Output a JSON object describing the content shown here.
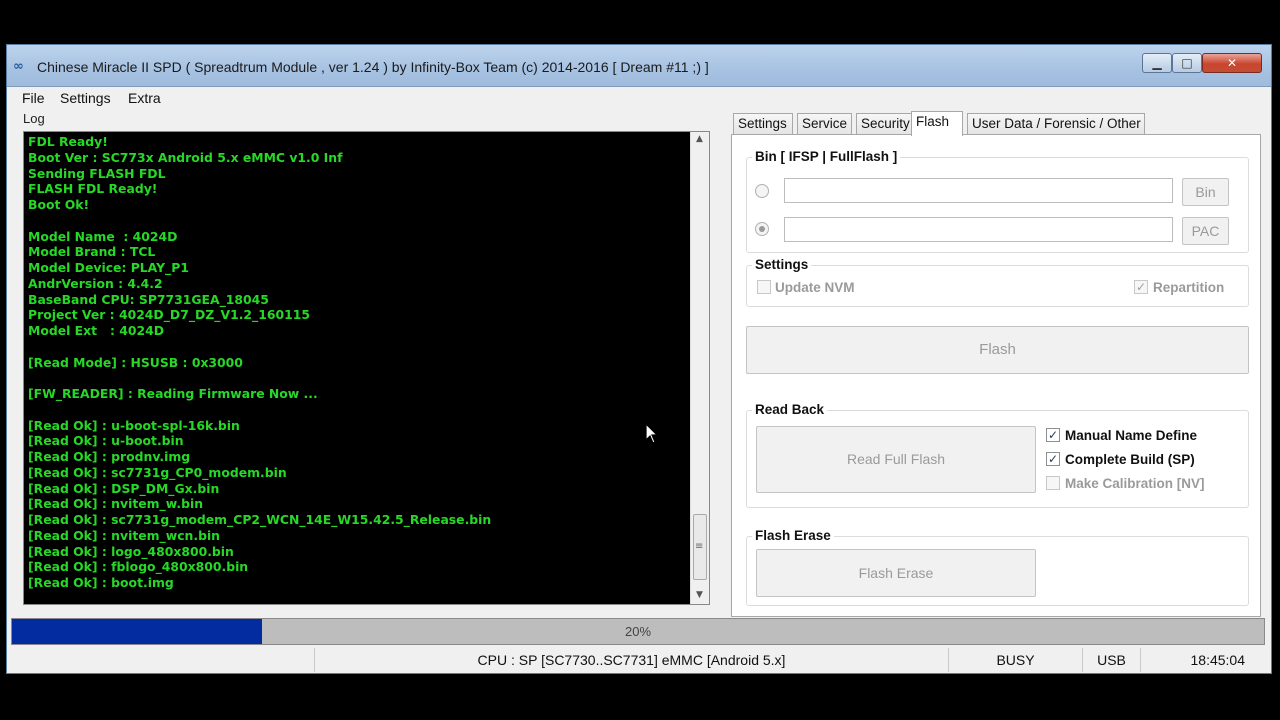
{
  "window": {
    "title": "Chinese Miracle II SPD ( Spreadtrum Module , ver 1.24 ) by Infinity-Box Team (c) 2014-2016 [ Dream #11 ;) ]",
    "icon": "infinity-logo-icon",
    "min_glyph": "▁",
    "max_glyph": "□",
    "close_glyph": "✕"
  },
  "menu": [
    "File",
    "Settings",
    "Extra"
  ],
  "log": {
    "label": "Log",
    "lines": [
      "FDL Ready!",
      "Boot Ver : SC773x Android 5.x eMMC v1.0 Inf",
      "Sending FLASH FDL",
      "FLASH FDL Ready!",
      "Boot Ok!",
      "",
      "Model Name  : 4024D",
      "Model Brand : TCL",
      "Model Device: PLAY_P1",
      "AndrVersion : 4.4.2",
      "BaseBand CPU: SP7731GEA_18045",
      "Project Ver : 4024D_D7_DZ_V1.2_160115",
      "Model Ext   : 4024D",
      "",
      "[Read Mode] : HSUSB : 0x3000",
      "",
      "[FW_READER] : Reading Firmware Now ...",
      "",
      "[Read Ok] : u-boot-spl-16k.bin",
      "[Read Ok] : u-boot.bin",
      "[Read Ok] : prodnv.img",
      "[Read Ok] : sc7731g_CP0_modem.bin",
      "[Read Ok] : DSP_DM_Gx.bin",
      "[Read Ok] : nvitem_w.bin",
      "[Read Ok] : sc7731g_modem_CP2_WCN_14E_W15.42.5_Release.bin",
      "[Read Ok] : nvitem_wcn.bin",
      "[Read Ok] : logo_480x800.bin",
      "[Read Ok] : fblogo_480x800.bin",
      "[Read Ok] : boot.img"
    ]
  },
  "tabs": [
    {
      "label": "Settings",
      "active": false
    },
    {
      "label": "Service",
      "active": false
    },
    {
      "label": "Security",
      "active": false
    },
    {
      "label": "Flash",
      "active": true
    },
    {
      "label": "User Data / Forensic / Other",
      "active": false
    }
  ],
  "flash_panel": {
    "bin_group": {
      "title": "Bin  [ IFSP | FullFlash ]",
      "bin_path_value": "",
      "pac_path_value": "",
      "bin_button": "Bin",
      "pac_button": "PAC",
      "selected": "pac"
    },
    "settings_group": {
      "title": "Settings",
      "update_nvm_label": "Update NVM",
      "update_nvm_checked": false,
      "repartition_label": "Repartition",
      "repartition_checked": true
    },
    "flash_button": "Flash",
    "read_back_group": {
      "title": "Read Back",
      "read_full_flash_button": "Read Full Flash",
      "manual_name_define_label": "Manual Name Define",
      "manual_name_define_checked": true,
      "complete_build_label": "Complete Build (SP)",
      "complete_build_checked": true,
      "make_calibration_label": "Make Calibration [NV]",
      "make_calibration_checked": false
    },
    "flash_erase_group": {
      "title": "Flash Erase",
      "flash_erase_button": "Flash Erase"
    }
  },
  "progress": {
    "percent": 20,
    "label": "20%"
  },
  "status": {
    "blank": "",
    "cpu": "CPU : SP [SC7730..SC7731] eMMC [Android 5.x]",
    "state": "BUSY",
    "connection": "USB",
    "time": "18:45:04"
  },
  "colors": {
    "log_text": "#27d827",
    "log_background": "#000000",
    "progress_fill": "#032ca0"
  }
}
